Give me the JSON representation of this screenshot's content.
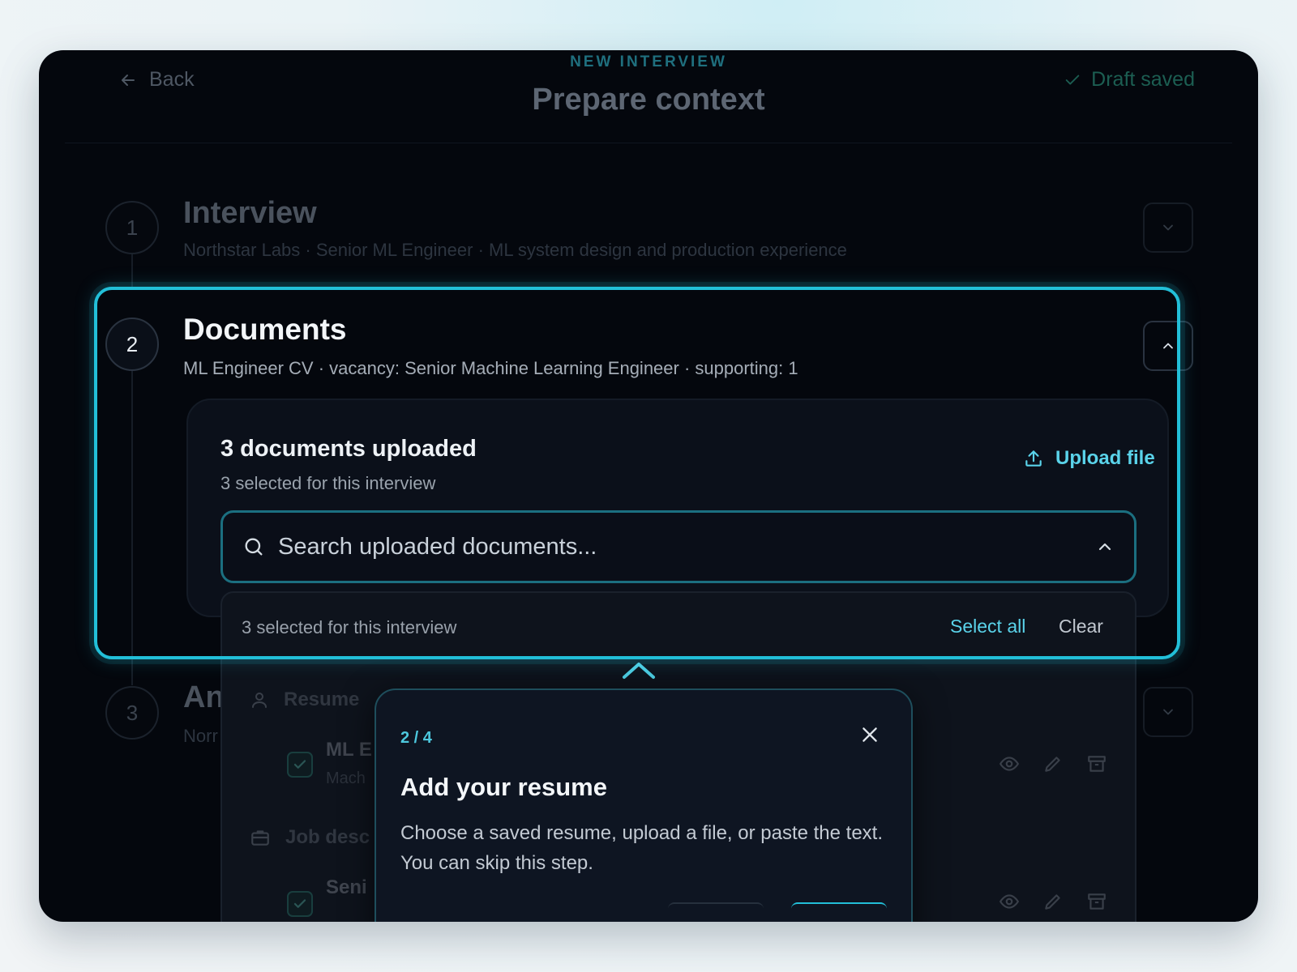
{
  "header": {
    "eyebrow": "NEW INTERVIEW",
    "title": "Prepare context",
    "back_label": "Back",
    "draft_status": "Draft saved"
  },
  "steps": [
    {
      "number": "1",
      "title": "Interview",
      "subtitle": "Northstar Labs · Senior ML Engineer · ML system design and production experience"
    },
    {
      "number": "2",
      "title": "Documents",
      "subtitle": "ML Engineer CV · vacancy: Senior Machine Learning Engineer · supporting: 1"
    },
    {
      "number": "3",
      "title": "An",
      "subtitle": "Norr"
    }
  ],
  "documents": {
    "heading": "3 documents uploaded",
    "subheading": "3 selected for this interview",
    "upload_label": "Upload file",
    "search_placeholder": "Search uploaded documents...",
    "dropdown": {
      "status": "3 selected for this interview",
      "select_all": "Select all",
      "clear": "Clear",
      "groups": [
        {
          "label": "Resume",
          "icon": "user-icon",
          "item_title": "ML E",
          "item_sub": "Mach"
        },
        {
          "label": "Job desc",
          "icon": "briefcase-icon",
          "item_title": "Seni",
          "item_sub": ""
        }
      ]
    }
  },
  "tour": {
    "progress": "2 / 4",
    "title": "Add your resume",
    "body": "Choose a saved resume, upload a file, or paste the text. You can skip this step."
  },
  "colors": {
    "accent": "#22bfd8",
    "accent_text": "#5ad3ea",
    "background": "#04070d",
    "success": "#1c5e52"
  }
}
